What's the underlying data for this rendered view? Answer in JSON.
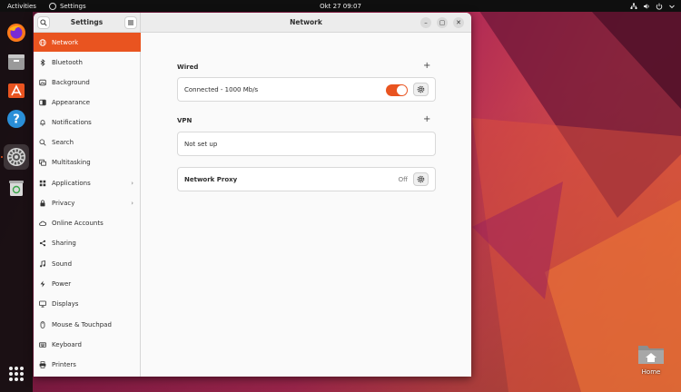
{
  "topbar": {
    "activities": "Activities",
    "app_name": "Settings",
    "clock": "Okt 27  09:07",
    "tray_icons": [
      "network-icon",
      "volume-icon",
      "power-icon",
      "chevron-down-icon"
    ]
  },
  "dock": {
    "apps": [
      {
        "name": "firefox",
        "icon": "firefox-icon"
      },
      {
        "name": "files",
        "icon": "files-icon"
      },
      {
        "name": "software",
        "icon": "ubuntu-software-icon"
      },
      {
        "name": "help",
        "icon": "help-icon"
      },
      {
        "name": "settings",
        "icon": "settings-icon",
        "active": true
      },
      {
        "name": "trash",
        "icon": "trash-icon"
      }
    ],
    "show_apps": "grid-icon"
  },
  "desktop": {
    "home_label": "Home"
  },
  "window": {
    "sidebar_title": "Settings",
    "main_title": "Network",
    "controls": {
      "minimize": "–",
      "maximize": "▢",
      "close": "✕"
    }
  },
  "sidebar": {
    "items": [
      {
        "label": "Network",
        "icon": "network-icon",
        "selected": true
      },
      {
        "label": "Bluetooth",
        "icon": "bluetooth-icon"
      },
      {
        "label": "Background",
        "icon": "background-icon"
      },
      {
        "label": "Appearance",
        "icon": "appearance-icon"
      },
      {
        "label": "Notifications",
        "icon": "bell-icon"
      },
      {
        "label": "Search",
        "icon": "search-icon"
      },
      {
        "label": "Multitasking",
        "icon": "multitasking-icon"
      },
      {
        "label": "Applications",
        "icon": "applications-icon",
        "chevron": true
      },
      {
        "label": "Privacy",
        "icon": "privacy-icon",
        "chevron": true
      },
      {
        "label": "Online Accounts",
        "icon": "cloud-icon"
      },
      {
        "label": "Sharing",
        "icon": "sharing-icon"
      },
      {
        "label": "Sound",
        "icon": "music-note-icon"
      },
      {
        "label": "Power",
        "icon": "power-icon"
      },
      {
        "label": "Displays",
        "icon": "display-icon"
      },
      {
        "label": "Mouse & Touchpad",
        "icon": "mouse-icon"
      },
      {
        "label": "Keyboard",
        "icon": "keyboard-icon"
      },
      {
        "label": "Printers",
        "icon": "printer-icon"
      }
    ]
  },
  "network": {
    "wired": {
      "title": "Wired",
      "status": "Connected - 1000 Mb/s",
      "enabled": true
    },
    "vpn": {
      "title": "VPN",
      "status": "Not set up"
    },
    "proxy": {
      "label": "Network Proxy",
      "state": "Off"
    }
  },
  "colors": {
    "accent": "#e95420",
    "topbar": "#0f0f0f",
    "window_bg": "#fafafa"
  }
}
